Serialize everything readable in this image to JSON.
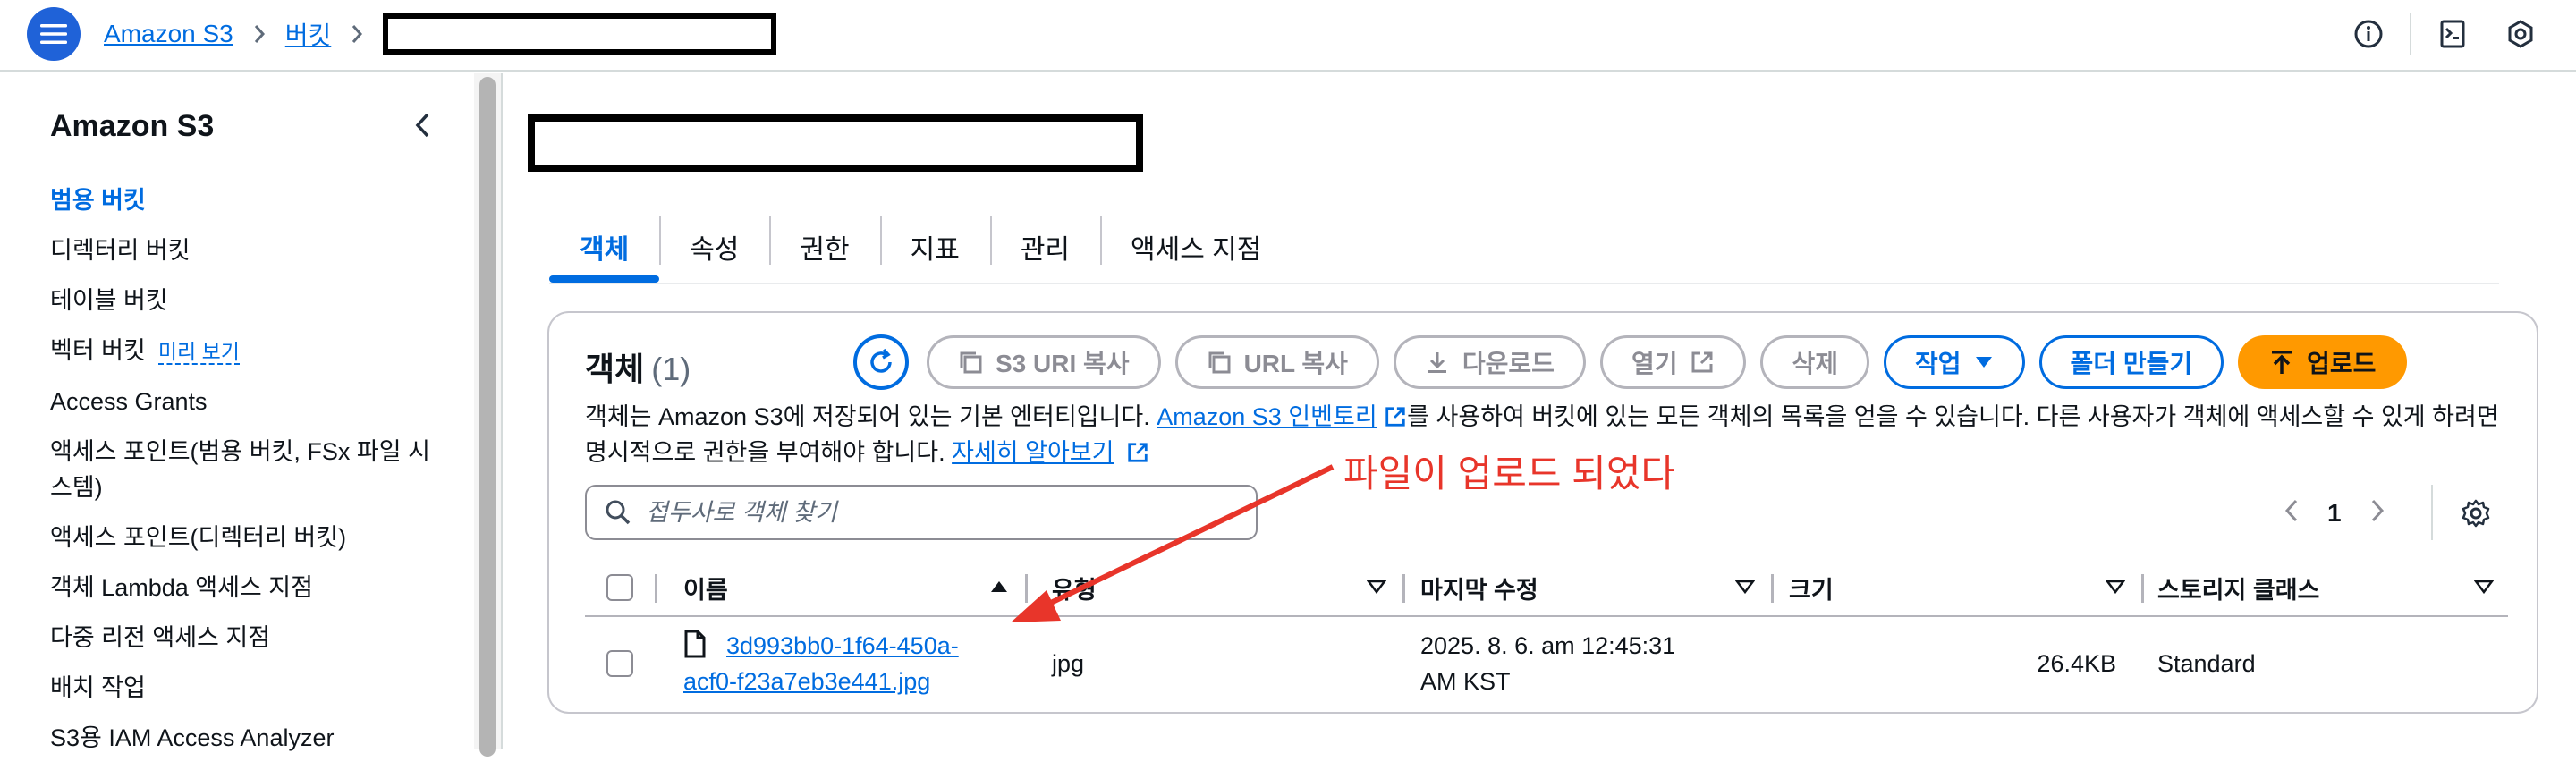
{
  "topbar": {
    "breadcrumb": [
      "Amazon S3",
      "버킷"
    ],
    "icons": [
      "info-icon",
      "cloudshell-icon",
      "notifications-icon"
    ]
  },
  "sidebar": {
    "title": "Amazon S3",
    "items": [
      {
        "label": "범용 버킷",
        "active": true
      },
      {
        "label": "디렉터리 버킷"
      },
      {
        "label": "테이블 버킷"
      },
      {
        "label": "벡터 버킷",
        "badge": "미리 보기"
      },
      {
        "label": "Access Grants"
      },
      {
        "label": "액세스 포인트(범용 버킷, FSx 파일 시스템)"
      },
      {
        "label": "액세스 포인트(디렉터리 버킷)"
      },
      {
        "label": "객체 Lambda 액세스 지점"
      },
      {
        "label": "다중 리전 액세스 지점"
      },
      {
        "label": "배치 작업"
      },
      {
        "label": "S3용 IAM Access Analyzer"
      }
    ]
  },
  "tabs": [
    "객체",
    "속성",
    "권한",
    "지표",
    "관리",
    "액세스 지점"
  ],
  "panel": {
    "title": "객체",
    "count": "(1)",
    "buttons": {
      "copy_uri": "S3 URI 복사",
      "copy_url": "URL 복사",
      "download": "다운로드",
      "open": "열기",
      "delete": "삭제",
      "actions": "작업",
      "create_folder": "폴더 만들기",
      "upload": "업로드"
    },
    "description": {
      "part1": "객체는 Amazon S3에 저장되어 있는 기본 엔터티입니다. ",
      "inventory_link": "Amazon S3 인벤토리",
      "part2": "를 사용하여 버킷에 있는 모든 객체의 목록을 얻을 수 있습니다. 다른 사용자가 객체에 액세스할 수 있게 하려면 명시적으로 권한을 부여해야 합니다. ",
      "learn_more": "자세히 알아보기"
    },
    "search_placeholder": "접두사로 객체 찾기",
    "pager": {
      "current_page": "1"
    },
    "columns": [
      "이름",
      "유형",
      "마지막 수정",
      "크기",
      "스토리지 클래스"
    ],
    "rows": [
      {
        "name_line1": "3d993bb0-1f64-450a-",
        "name_line2": "acf0-f23a7eb3e441.jpg",
        "type": "jpg",
        "modified_line1": "2025. 8. 6. am 12:45:31",
        "modified_line2": "AM KST",
        "size": "26.4KB",
        "storage_class": "Standard"
      }
    ]
  },
  "annotation": {
    "text": "파일이 업로드 되었다",
    "color": "#e8352a"
  },
  "colors": {
    "link": "#006ce0",
    "upload_button": "#ff9900",
    "menu_button": "#1f62d8"
  }
}
